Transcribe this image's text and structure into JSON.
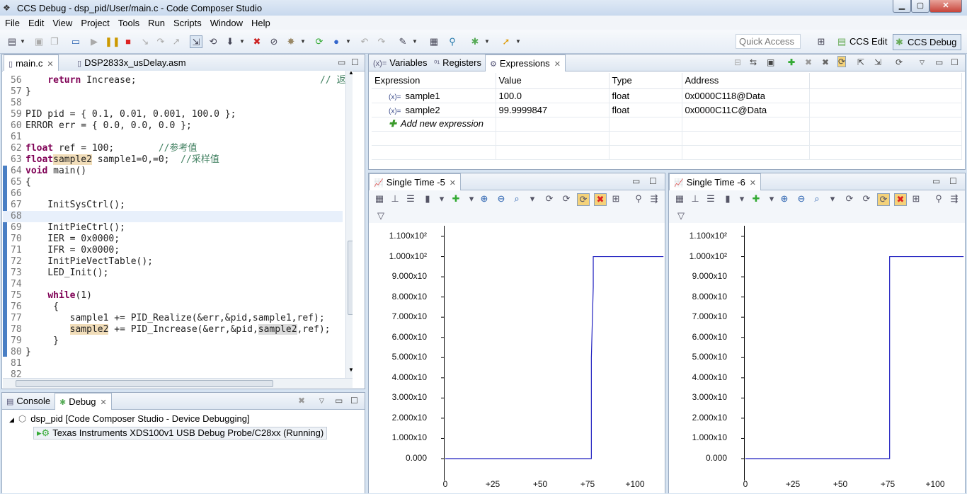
{
  "window": {
    "title": "CCS Debug - dsp_pid/User/main.c - Code Composer Studio",
    "min": "▁",
    "max": "▢",
    "close": "✕"
  },
  "menu": [
    "File",
    "Edit",
    "View",
    "Project",
    "Tools",
    "Run",
    "Scripts",
    "Window",
    "Help"
  ],
  "quick_access": {
    "placeholder": "Quick Access"
  },
  "perspectives": {
    "edit": "CCS Edit",
    "debug": "CCS Debug"
  },
  "editor": {
    "tabs": [
      {
        "label": "main.c",
        "close": "✕"
      },
      {
        "label": "DSP2833x_usDelay.asm"
      }
    ],
    "lines": [
      {
        "no": "56",
        "pre": "    ",
        "kw": "return",
        "rest": " Increase;",
        "comment_right": "// 返"
      },
      {
        "no": "57",
        "text": "}"
      },
      {
        "no": "58",
        "text": ""
      },
      {
        "no": "59",
        "text": "PID pid = { 0.1, 0.01, 0.001, 100.0 };"
      },
      {
        "no": "60",
        "text": "ERROR err = { 0.0, 0.0, 0.0 };"
      },
      {
        "no": "61",
        "text": ""
      },
      {
        "no": "62",
        "kw": "float",
        "rest": " ref = 100;        ",
        "cm": "//参考值"
      },
      {
        "no": "63",
        "kw": "float",
        "rest": " sample1=0,",
        "hl": "sample2",
        "rest2": "=0;  ",
        "cm": "//采样值"
      },
      {
        "no": "64",
        "kw": "void",
        "rest": " main()"
      },
      {
        "no": "65",
        "text": "{"
      },
      {
        "no": "66",
        "text": ""
      },
      {
        "no": "67",
        "text": "    InitSysCtrl();"
      },
      {
        "no": "68",
        "text": "",
        "current": true
      },
      {
        "no": "69",
        "text": "    InitPieCtrl();"
      },
      {
        "no": "70",
        "text": "    IER = 0x0000;"
      },
      {
        "no": "71",
        "text": "    IFR = 0x0000;"
      },
      {
        "no": "72",
        "text": "    InitPieVectTable();"
      },
      {
        "no": "73",
        "text": "    LED_Init();"
      },
      {
        "no": "74",
        "text": ""
      },
      {
        "no": "75",
        "pre": "    ",
        "kw": "while",
        "rest": "(1)"
      },
      {
        "no": "76",
        "text": "     {"
      },
      {
        "no": "77",
        "text": "        sample1 += PID_Realize(&err,&pid,sample1,ref);"
      },
      {
        "no": "78",
        "pre": "        ",
        "hl": "sample2",
        "rest": " += PID_Increase(&err,&pid,",
        "hl2": "sample2",
        "rest2": ",ref);"
      },
      {
        "no": "79",
        "text": "     }"
      },
      {
        "no": "80",
        "text": "}"
      },
      {
        "no": "81",
        "text": ""
      },
      {
        "no": "82",
        "text": ""
      }
    ]
  },
  "expressions_view": {
    "tabs": [
      {
        "label": "Variables"
      },
      {
        "label": "Registers"
      },
      {
        "label": "Expressions",
        "close": "✕"
      }
    ],
    "columns": [
      "Expression",
      "Value",
      "Type",
      "Address"
    ],
    "rows": [
      {
        "expression": "sample1",
        "value": "100.0",
        "type": "float",
        "address": "0x0000C118@Data"
      },
      {
        "expression": "sample2",
        "value": "99.9999847",
        "type": "float",
        "address": "0x0000C11C@Data"
      }
    ],
    "add_new": "Add new expression"
  },
  "graphs": [
    {
      "tab": "Single Time -5",
      "close": "✕",
      "chart_data": {
        "type": "line",
        "ytick_labels": [
          "1.100x10²",
          "1.000x10²",
          "9.000x10",
          "8.000x10",
          "7.000x10",
          "6.000x10",
          "5.000x10",
          "4.000x10",
          "3.000x10",
          "2.000x10",
          "1.000x10",
          "0.000"
        ],
        "xtick_labels": [
          "0",
          "+25",
          "+50",
          "+75",
          "+100"
        ],
        "ylim": [
          0,
          110
        ],
        "xlim": [
          0,
          115
        ],
        "series": [
          {
            "color": "#1f1fbf",
            "x": [
              0,
              77,
              77,
              78,
              78,
              115
            ],
            "y": [
              0,
              0,
              50,
              85,
              100,
              100
            ]
          }
        ]
      }
    },
    {
      "tab": "Single Time -6",
      "close": "✕",
      "chart_data": {
        "type": "line",
        "ytick_labels": [
          "1.100x10²",
          "1.000x10²",
          "9.000x10",
          "8.000x10",
          "7.000x10",
          "6.000x10",
          "5.000x10",
          "4.000x10",
          "3.000x10",
          "2.000x10",
          "1.000x10",
          "0.000"
        ],
        "xtick_labels": [
          "0",
          "+25",
          "+50",
          "+75",
          "+100"
        ],
        "ylim": [
          0,
          110
        ],
        "xlim": [
          0,
          115
        ],
        "series": [
          {
            "color": "#1f1fbf",
            "x": [
              0,
              76,
              76,
              115
            ],
            "y": [
              0,
              0,
              100,
              100
            ]
          }
        ]
      }
    }
  ],
  "bottom": {
    "tabs": [
      {
        "label": "Console"
      },
      {
        "label": "Debug",
        "close": "✕"
      }
    ],
    "tree": [
      {
        "label": "dsp_pid [Code Composer Studio - Device Debugging]"
      },
      {
        "label": "Texas Instruments XDS100v1 USB Debug Probe/C28xx (Running)"
      }
    ]
  }
}
